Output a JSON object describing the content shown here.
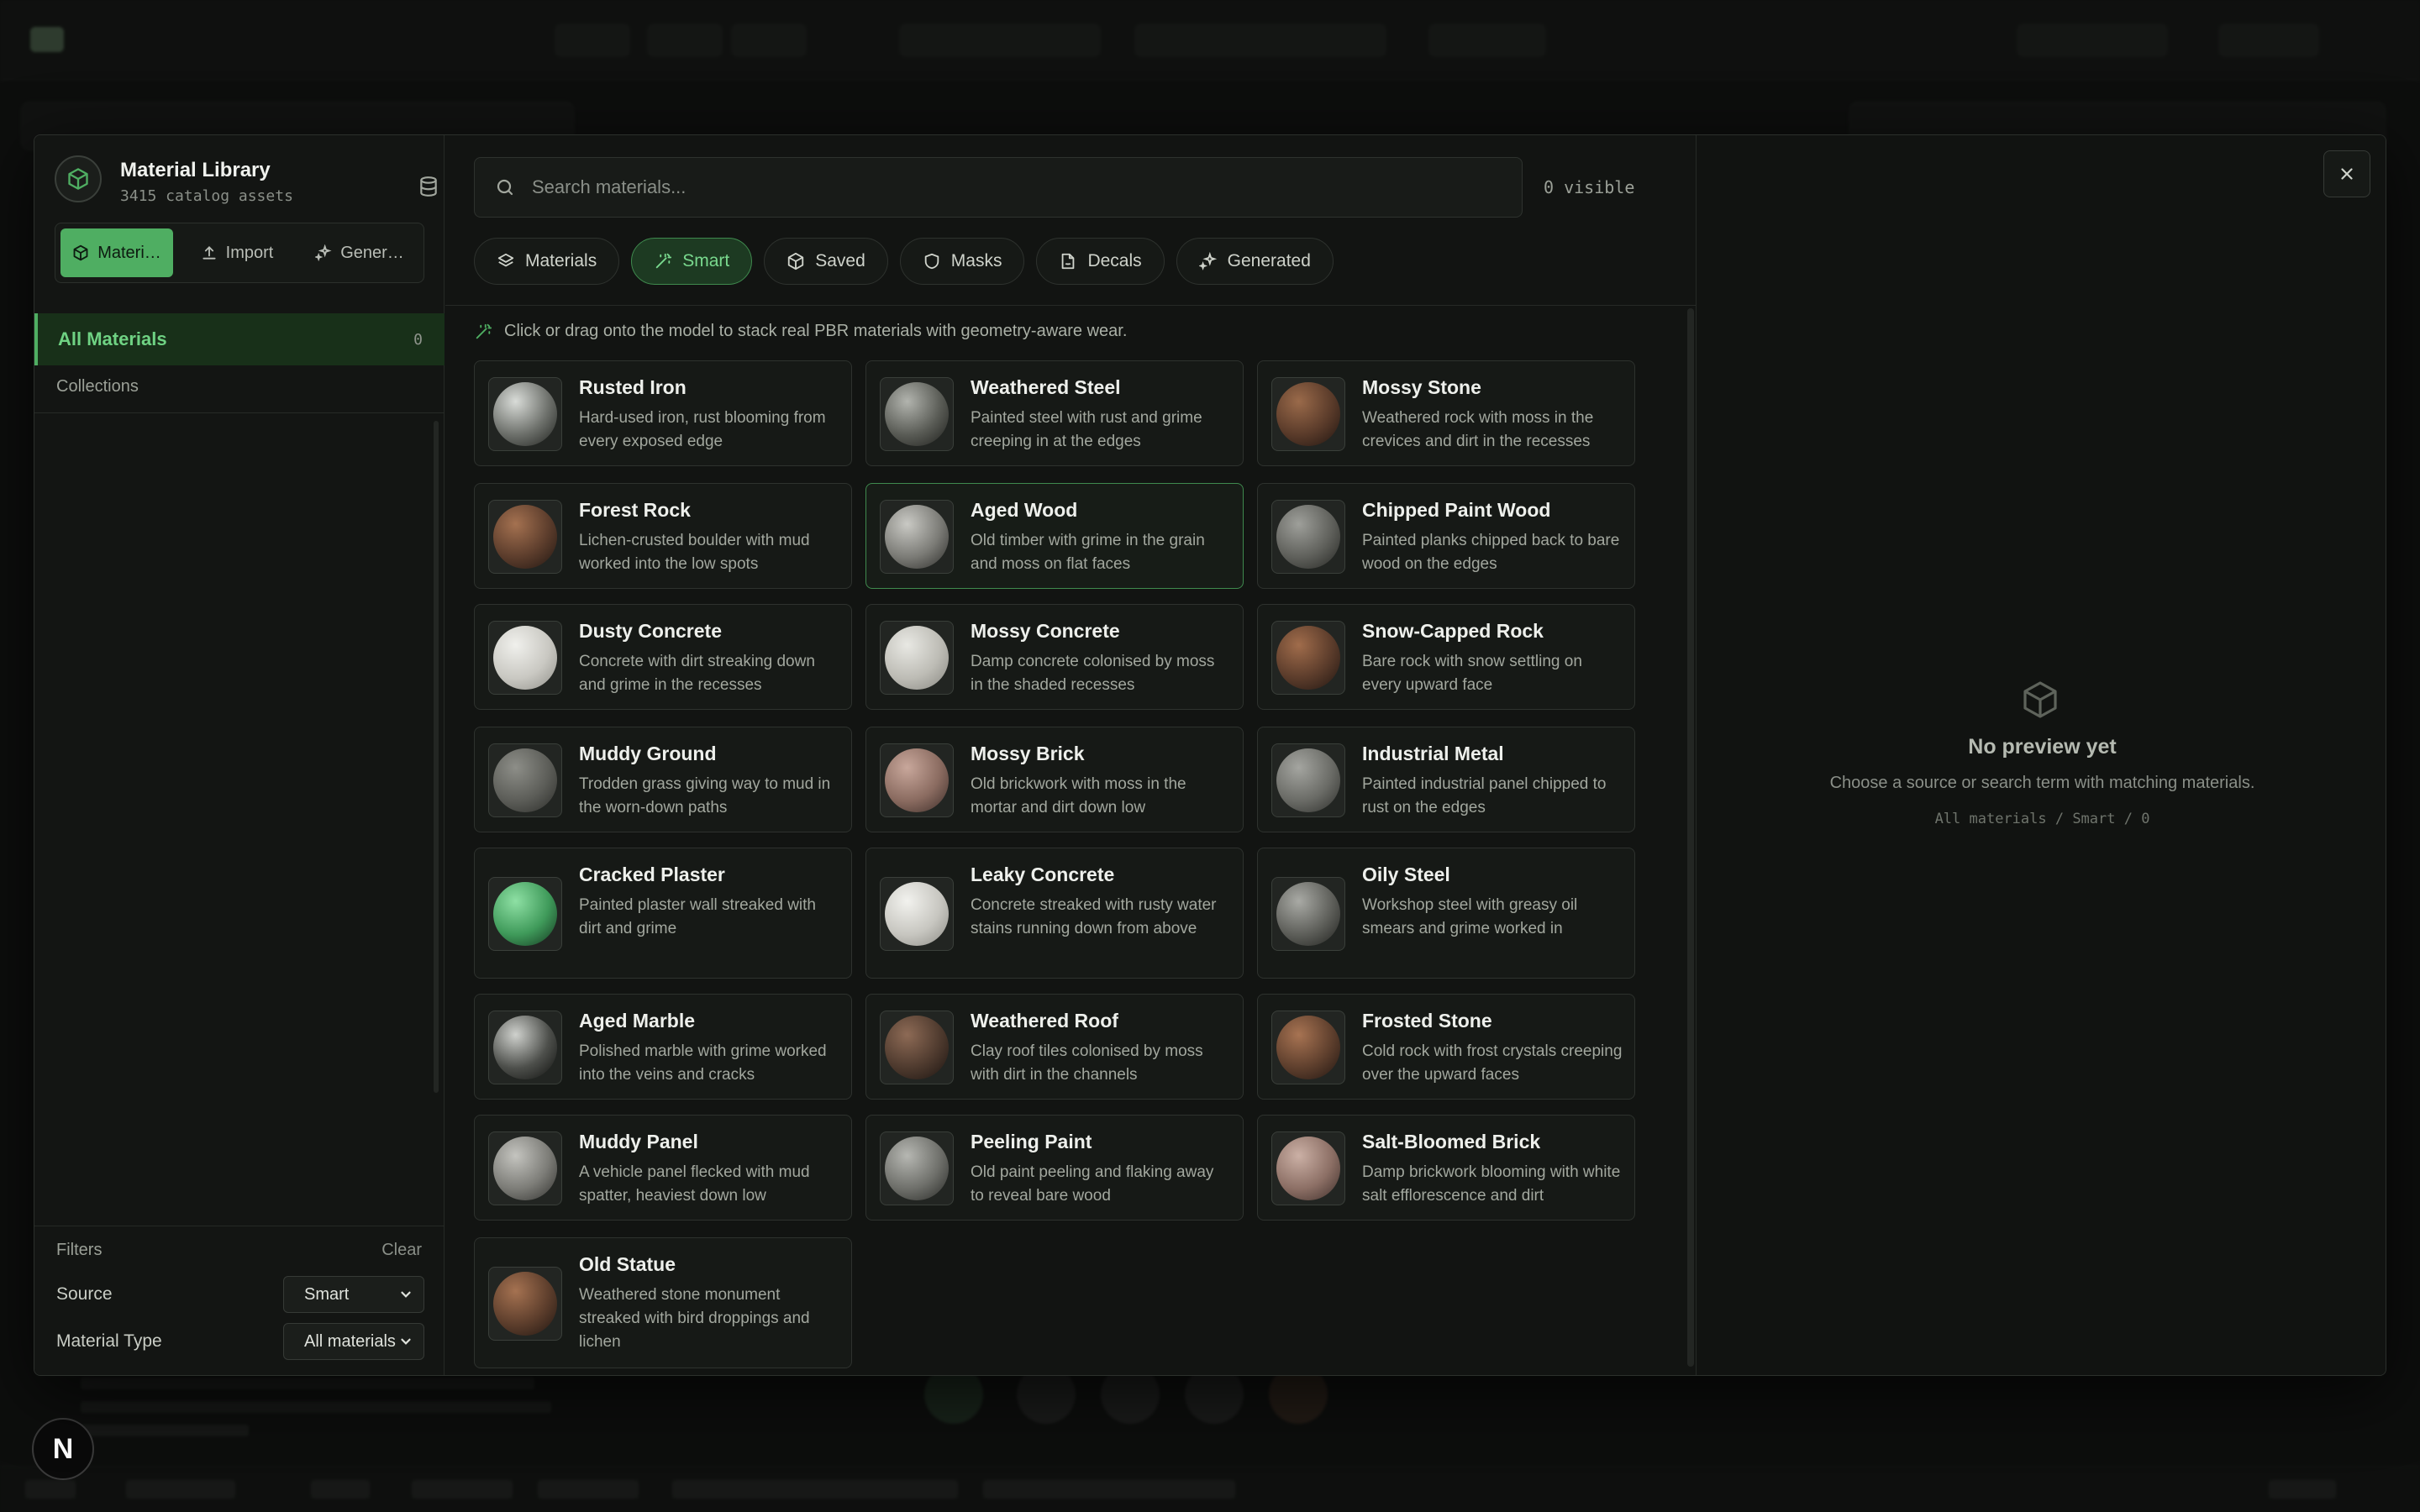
{
  "library": {
    "title": "Material Library",
    "subtitle": "3415 catalog assets",
    "source_tabs": [
      {
        "label": "Materi…",
        "icon": "cube-icon",
        "active": true
      },
      {
        "label": "Import",
        "icon": "upload-icon",
        "active": false
      },
      {
        "label": "Gener…",
        "icon": "sparkles-icon",
        "active": false
      }
    ]
  },
  "sidebar": {
    "all_materials_label": "All Materials",
    "all_materials_count": "0",
    "collections_label": "Collections"
  },
  "filters": {
    "title": "Filters",
    "clear_label": "Clear",
    "source_label": "Source",
    "source_value": "Smart",
    "type_label": "Material Type",
    "type_value": "All materials"
  },
  "search": {
    "placeholder": "Search materials...",
    "visible_count": "0 visible"
  },
  "type_tabs": [
    {
      "label": "Materials",
      "icon": "layers-icon",
      "active": false
    },
    {
      "label": "Smart",
      "icon": "magic-wand-icon",
      "active": true
    },
    {
      "label": "Saved",
      "icon": "cube-icon",
      "active": false
    },
    {
      "label": "Masks",
      "icon": "shield-icon",
      "active": false
    },
    {
      "label": "Decals",
      "icon": "sticker-icon",
      "active": false
    },
    {
      "label": "Generated",
      "icon": "sparkles-icon",
      "active": false
    }
  ],
  "hint": "Click or drag onto the model to stack real PBR materials with geometry-aware wear.",
  "materials": [
    {
      "name": "Rusted Iron",
      "desc": "Hard-used iron, rust blooming from every exposed edge",
      "swatch": [
        "#d9dcd8",
        "#6d706b",
        "#1d1f1c"
      ]
    },
    {
      "name": "Weathered Steel",
      "desc": "Painted steel with rust and grime creeping in at the edges",
      "swatch": [
        "#b2b4ae",
        "#5a5c56",
        "#1c1d1a"
      ]
    },
    {
      "name": "Mossy Stone",
      "desc": "Weathered rock with moss in the crevices and dirt in the recesses",
      "swatch": [
        "#9a6a4a",
        "#5a3b2a",
        "#1e1410"
      ]
    },
    {
      "name": "Forest Rock",
      "desc": "Lichen-crusted boulder with mud worked into the low spots",
      "swatch": [
        "#a47150",
        "#5c3d2c",
        "#1f1511"
      ]
    },
    {
      "name": "Aged Wood",
      "desc": "Old timber with grime in the grain and moss on flat faces",
      "swatch": [
        "#c9c9c4",
        "#7b7b76",
        "#2a2a27"
      ]
    },
    {
      "name": "Chipped Paint Wood",
      "desc": "Painted planks chipped back to bare wood on the edges",
      "swatch": [
        "#9e9f9a",
        "#5f605b",
        "#242522"
      ]
    },
    {
      "name": "Dusty Concrete",
      "desc": "Concrete with dirt streaking down and grime in the recesses",
      "swatch": [
        "#f0f0ec",
        "#c9c8c2",
        "#8e8d87"
      ]
    },
    {
      "name": "Mossy Concrete",
      "desc": "Damp concrete colonised by moss in the shaded recesses",
      "swatch": [
        "#e8e8e3",
        "#bdbcb5",
        "#86857f"
      ]
    },
    {
      "name": "Snow-Capped Rock",
      "desc": "Bare rock with snow settling on every upward face",
      "swatch": [
        "#a06c4b",
        "#5b3c2b",
        "#1f1511"
      ]
    },
    {
      "name": "Muddy Ground",
      "desc": "Trodden grass giving way to mud in the worn-down paths",
      "swatch": [
        "#8d8e88",
        "#5c5d58",
        "#2a2b28"
      ]
    },
    {
      "name": "Mossy Brick",
      "desc": "Old brickwork with moss in the mortar and dirt down low",
      "swatch": [
        "#c8a79b",
        "#8a6b60",
        "#3a2b27"
      ]
    },
    {
      "name": "Industrial Metal",
      "desc": "Painted industrial panel chipped to rust on the edges",
      "swatch": [
        "#a4a5a0",
        "#6a6b66",
        "#2c2d2a"
      ]
    },
    {
      "name": "Cracked Plaster",
      "desc": "Painted plaster wall streaked with dirt and grime",
      "swatch": [
        "#8ee0a4",
        "#3f9a5a",
        "#12331d"
      ]
    },
    {
      "name": "Leaky Concrete",
      "desc": "Concrete streaked with rusty water stains running down from above",
      "swatch": [
        "#f2f2ee",
        "#c7c6c0",
        "#8a8983"
      ]
    },
    {
      "name": "Oily Steel",
      "desc": "Workshop steel with greasy oil smears and grime worked in",
      "swatch": [
        "#a9aaa5",
        "#5e5f5a",
        "#1f201d"
      ]
    },
    {
      "name": "Aged Marble",
      "desc": "Polished marble with grime worked into the veins and cracks",
      "swatch": [
        "#cfd1cd",
        "#4d4f4b",
        "#0d0e0c"
      ]
    },
    {
      "name": "Weathered Roof",
      "desc": "Clay roof tiles colonised by moss with dirt in the channels",
      "swatch": [
        "#8d6a55",
        "#4e3a2e",
        "#1a1310"
      ]
    },
    {
      "name": "Frosted Stone",
      "desc": "Cold rock with frost crystals creeping over the upward faces",
      "swatch": [
        "#a77352",
        "#5e3f2d",
        "#1f1511"
      ]
    },
    {
      "name": "Muddy Panel",
      "desc": "A vehicle panel flecked with mud spatter, heaviest down low",
      "swatch": [
        "#c4c4bf",
        "#7c7c77",
        "#2f2f2c"
      ]
    },
    {
      "name": "Peeling Paint",
      "desc": "Old paint peeling and flaking away to reveal bare wood",
      "swatch": [
        "#b6b7b2",
        "#6e6f6a",
        "#262724"
      ]
    },
    {
      "name": "Salt-Bloomed Brick",
      "desc": "Damp brickwork blooming with white salt efflorescence and dirt",
      "swatch": [
        "#cbb0a5",
        "#8c6f65",
        "#3b2c28"
      ]
    },
    {
      "name": "Old Statue",
      "desc": "Weathered stone monument streaked with bird droppings and lichen",
      "swatch": [
        "#a57251",
        "#5d3e2c",
        "#1f1511"
      ]
    }
  ],
  "selected_material": "Aged Wood",
  "preview": {
    "empty_title": "No preview yet",
    "empty_sub": "Choose a source or search term with matching materials.",
    "path": "All materials / Smart / 0"
  },
  "colors": {
    "accent": "#4fae62",
    "accent_text": "#79d98e",
    "modal_bg": "#121412",
    "page_bg": "#0d0e0d"
  },
  "badge": "N"
}
